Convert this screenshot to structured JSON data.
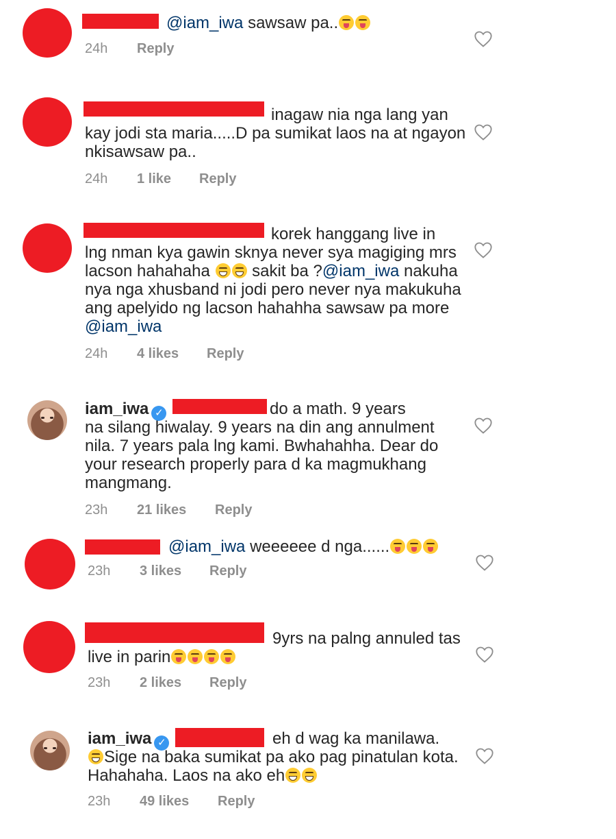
{
  "comments": [
    {
      "lines": [
        {
          "parts": [
            {
              "t": "@iam_iwa",
              "c": "mention"
            },
            {
              "t": " sawsaw pa.."
            }
          ],
          "emojis": [
            "tongue",
            "tongue"
          ]
        }
      ],
      "time": "24h",
      "likes": "",
      "reply": "Reply"
    },
    {
      "lines": [
        {
          "parts": [
            {
              "t": "inagaw nia nga lang yan"
            }
          ]
        },
        {
          "parts": [
            {
              "t": "kay jodi sta maria.....D pa sumikat laos na at ngayon"
            }
          ]
        },
        {
          "parts": [
            {
              "t": "nkisawsaw pa.."
            }
          ]
        }
      ],
      "time": "24h",
      "likes": "1 like",
      "reply": "Reply"
    },
    {
      "lines": [
        {
          "parts": [
            {
              "t": "korek hanggang live in"
            }
          ]
        },
        {
          "parts": [
            {
              "t": "lng nman kya gawin sknya never sya magiging mrs"
            }
          ]
        },
        {
          "parts": [
            {
              "t": "lacson hahahaha "
            }
          ],
          "emojis": [
            "laugh",
            "laugh"
          ],
          "after": [
            {
              "t": " sakit ba ?"
            },
            {
              "t": "@iam_iwa",
              "c": "mention"
            },
            {
              "t": " nakuha"
            }
          ]
        },
        {
          "parts": [
            {
              "t": "nya nga xhusband ni jodi pero never nya makukuha"
            }
          ]
        },
        {
          "parts": [
            {
              "t": "ang apelyido ng lacson hahahha sawsaw pa more"
            }
          ]
        },
        {
          "parts": [
            {
              "t": "@iam_iwa",
              "c": "mention"
            }
          ]
        }
      ],
      "time": "24h",
      "likes": "4 likes",
      "reply": "Reply"
    },
    {
      "username": "iam_iwa",
      "verified": "✓",
      "lines": [
        {
          "parts": [
            {
              "t": "do a math. 9 years"
            }
          ]
        },
        {
          "parts": [
            {
              "t": "na silang hiwalay. 9 years na din ang annulment"
            }
          ]
        },
        {
          "parts": [
            {
              "t": "nila. 7 years pala lng kami. Bwhahahha. Dear do"
            }
          ]
        },
        {
          "parts": [
            {
              "t": "your research properly para d ka magmukhang"
            }
          ]
        },
        {
          "parts": [
            {
              "t": "mangmang."
            }
          ]
        }
      ],
      "time": "23h",
      "likes": "21 likes",
      "reply": "Reply"
    },
    {
      "lines": [
        {
          "parts": [
            {
              "t": "@iam_iwa",
              "c": "mention"
            },
            {
              "t": " weeeeee d nga......"
            }
          ],
          "emojis": [
            "tongue",
            "tongue",
            "tongue"
          ]
        }
      ],
      "time": "23h",
      "likes": "3 likes",
      "reply": "Reply"
    },
    {
      "lines": [
        {
          "parts": [
            {
              "t": "9yrs na palng annuled tas"
            }
          ]
        },
        {
          "parts": [
            {
              "t": "live in parin"
            }
          ],
          "emojis": [
            "tongue",
            "tongue",
            "tongue",
            "tongue"
          ]
        }
      ],
      "time": "23h",
      "likes": "2 likes",
      "reply": "Reply"
    },
    {
      "username": "iam_iwa",
      "verified": "✓",
      "lines": [
        {
          "parts": [
            {
              "t": "eh d wag ka manilawa."
            }
          ]
        },
        {
          "parts": [],
          "emojis": [
            "laugh"
          ],
          "after": [
            {
              "t": "Sige na baka sumikat pa ako pag pinatulan kota."
            }
          ]
        },
        {
          "parts": [
            {
              "t": "Hahahaha. Laos na ako eh"
            }
          ],
          "emojis": [
            "laugh",
            "laugh"
          ]
        }
      ],
      "time": "23h",
      "likes": "49 likes",
      "reply": "Reply"
    }
  ],
  "colors": {
    "redaction": "#ed1c24",
    "mention": "#003569",
    "meta": "#8e8e8e",
    "verified": "#3897f0"
  },
  "icons": {
    "like": "heart-outline-icon",
    "verified": "verified-badge-icon"
  }
}
